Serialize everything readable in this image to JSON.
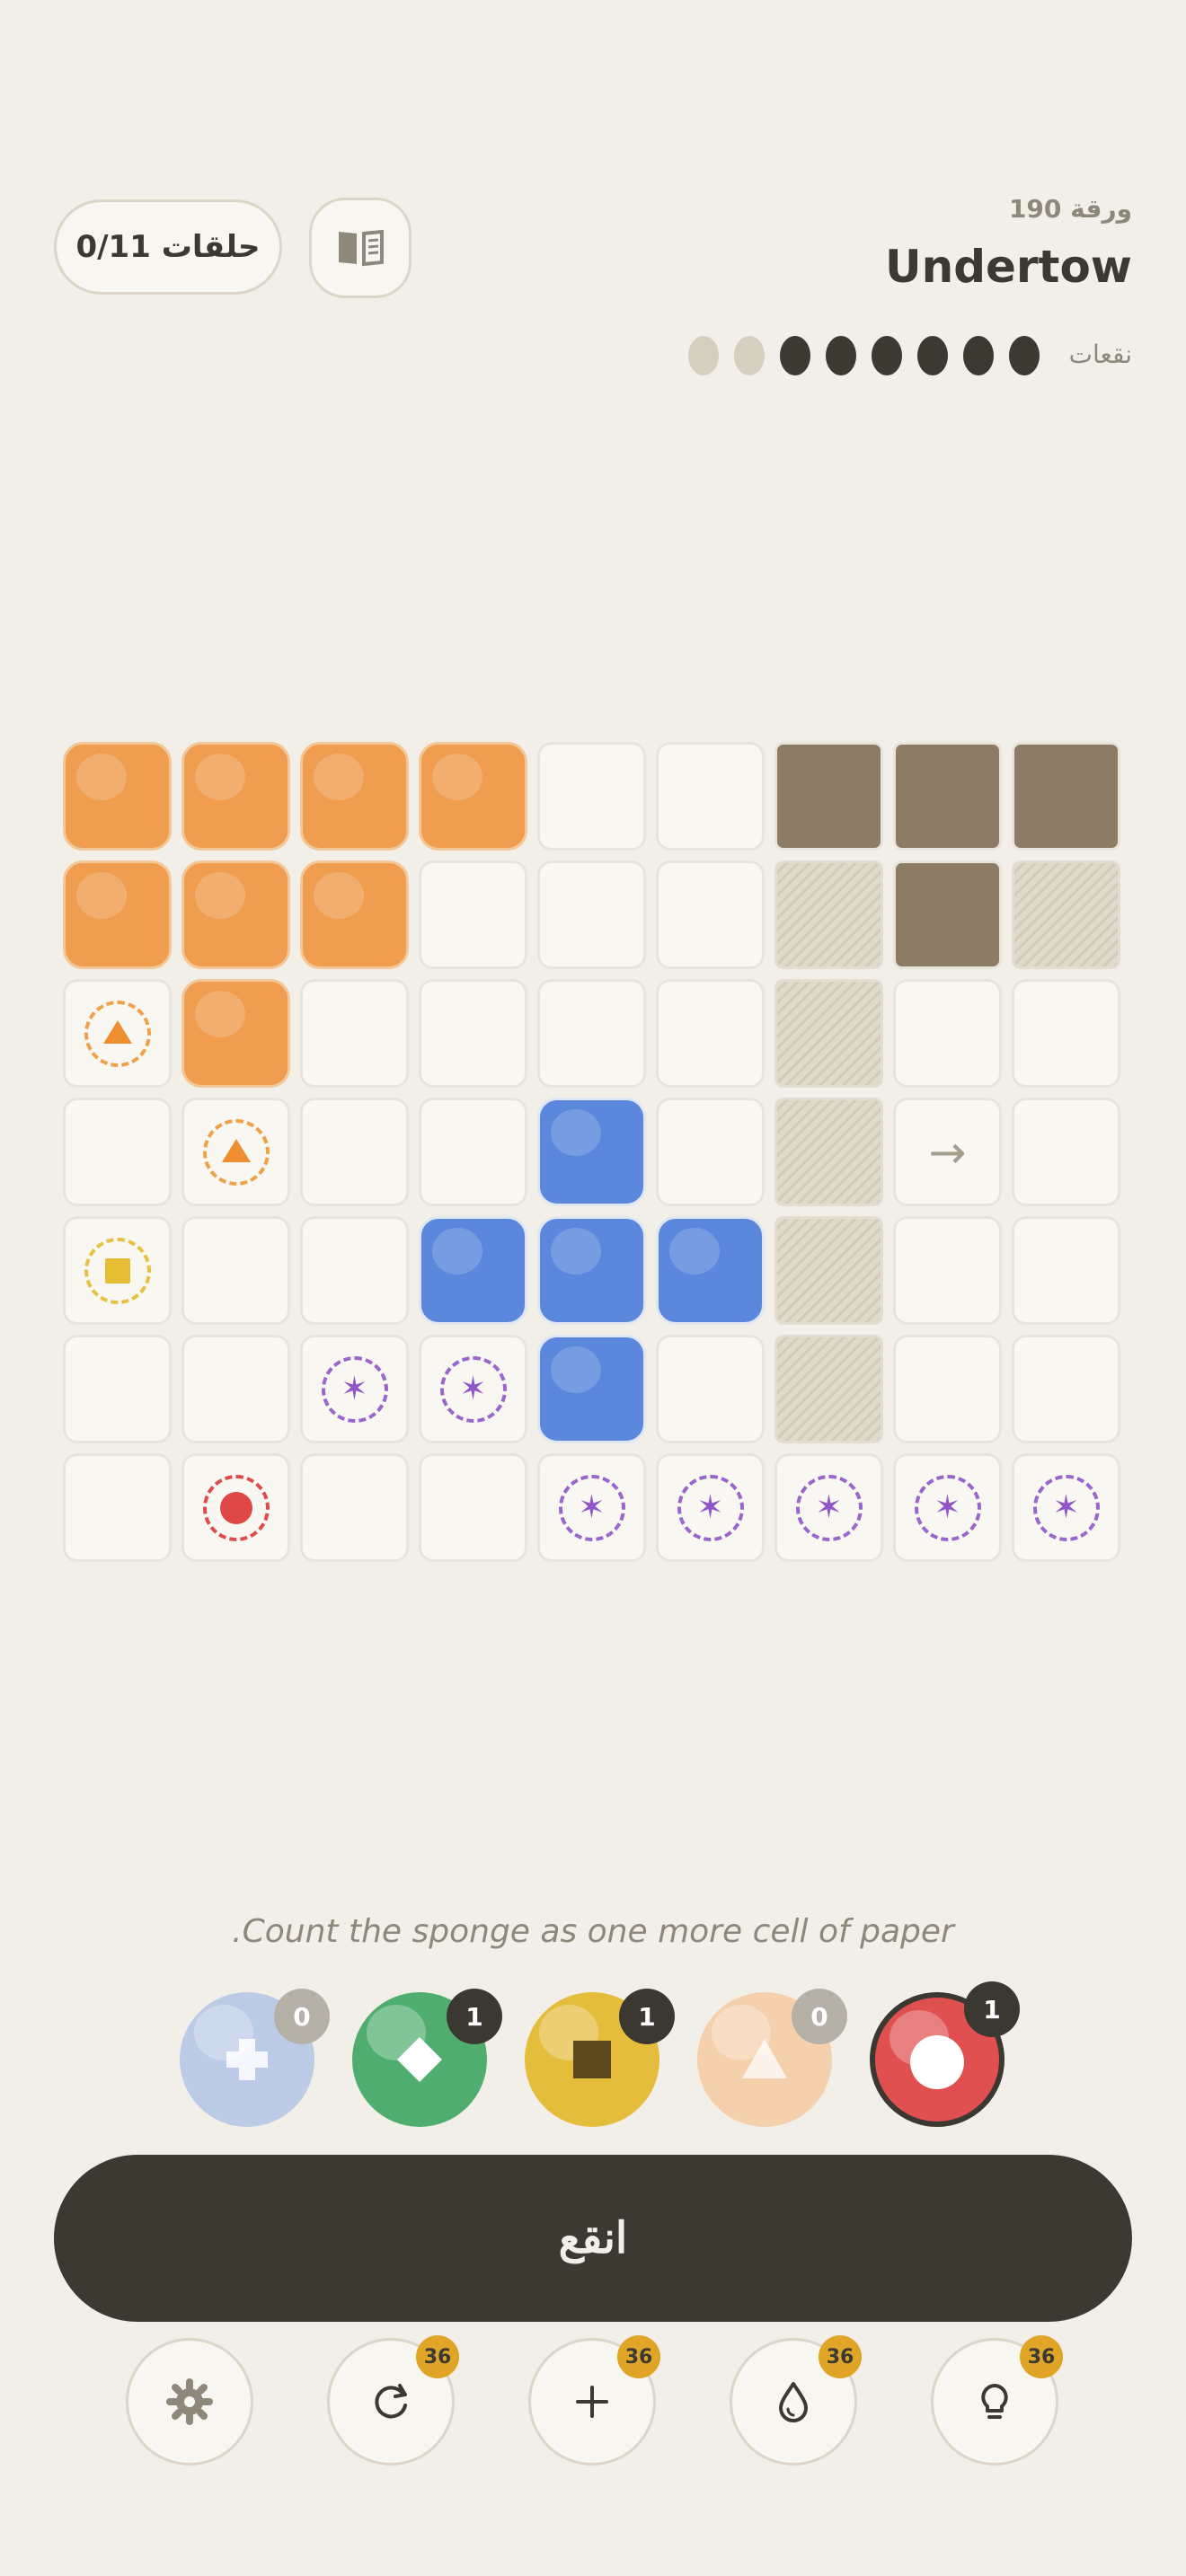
{
  "header": {
    "rings_label": "0/11 حلقات",
    "sheet_label": "ورقة 190",
    "level_title": "Undertow",
    "drops_label": "نقعات",
    "drops": {
      "total": 8,
      "filled": 6
    }
  },
  "board": {
    "rows": 7,
    "cols": 9,
    "cells": [
      [
        "orange",
        "orange",
        "orange",
        "orange",
        "empty",
        "empty",
        "brown",
        "brown",
        "brown"
      ],
      [
        "orange",
        "orange",
        "orange",
        "empty",
        "empty",
        "empty",
        "hatch",
        "brown",
        "hatch"
      ],
      [
        "ring-orange-triangle",
        "orange",
        "empty",
        "empty",
        "empty",
        "empty",
        "hatch",
        "empty",
        "empty"
      ],
      [
        "empty",
        "ring-orange-triangle",
        "empty",
        "empty",
        "blue",
        "empty",
        "hatch",
        "arrow-right",
        "empty"
      ],
      [
        "ring-yellow-square",
        "empty",
        "empty",
        "blue",
        "blue",
        "blue",
        "hatch",
        "empty",
        "empty"
      ],
      [
        "empty",
        "empty",
        "ring-purple-star",
        "ring-purple-star",
        "blue",
        "empty",
        "hatch",
        "empty",
        "empty"
      ],
      [
        "empty",
        "ring-red-dot",
        "empty",
        "empty",
        "ring-purple-star",
        "ring-purple-star",
        "ring-purple-star",
        "ring-purple-star",
        "ring-purple-star"
      ]
    ]
  },
  "hint": ".Count the sponge as one more cell of paper",
  "colors": [
    {
      "name": "blue",
      "icon": "plus-icon",
      "count": "0",
      "color": "#bccbe6",
      "selected": false,
      "dim": true
    },
    {
      "name": "green",
      "icon": "diamond-icon",
      "count": "1",
      "color": "#4fae6f",
      "selected": false,
      "dim": false
    },
    {
      "name": "yellow",
      "icon": "square-icon",
      "count": "1",
      "color": "#e4bd3c",
      "selected": false,
      "dim": false
    },
    {
      "name": "orange",
      "icon": "triangle-icon",
      "count": "0",
      "color": "#f5d0ad",
      "selected": false,
      "dim": true
    },
    {
      "name": "red",
      "icon": "circle-icon",
      "count": "1",
      "color": "#e05050",
      "selected": true,
      "dim": false
    }
  ],
  "main_button": {
    "label": "انقع"
  },
  "tools": [
    {
      "name": "settings",
      "icon": "gear-icon",
      "badge": null
    },
    {
      "name": "restart",
      "icon": "restart-icon",
      "badge": "36"
    },
    {
      "name": "add",
      "icon": "plus-icon",
      "badge": "36"
    },
    {
      "name": "drop",
      "icon": "drop-icon",
      "badge": "36"
    },
    {
      "name": "hint",
      "icon": "lightbulb-icon",
      "badge": "36"
    }
  ]
}
